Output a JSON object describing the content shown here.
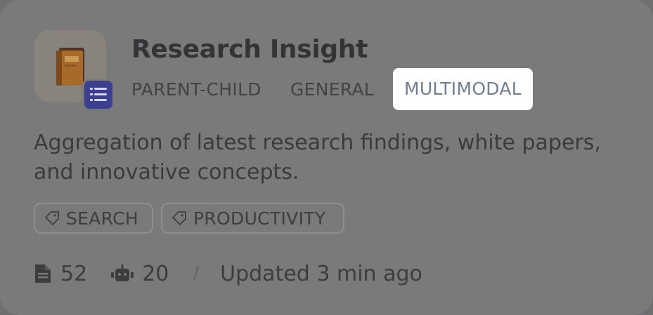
{
  "card": {
    "title": "Research Insight",
    "icon": "book-icon",
    "badge_icon": "list-icon",
    "types": [
      "PARENT-CHILD",
      "GENERAL",
      "MULTIMODAL"
    ],
    "description_line1": "Aggregation of latest research findings, white papers,",
    "description_line2": "and innovative concepts.",
    "tags": [
      "SEARCH",
      "PRODUCTIVITY"
    ],
    "stats": {
      "documents": "52",
      "apps": "20",
      "separator": "/",
      "updated": "Updated 3 min ago"
    }
  },
  "colors": {
    "overlay": "#6f6f71",
    "highlight": "#ffffff",
    "badge": "#3b3f8e"
  }
}
